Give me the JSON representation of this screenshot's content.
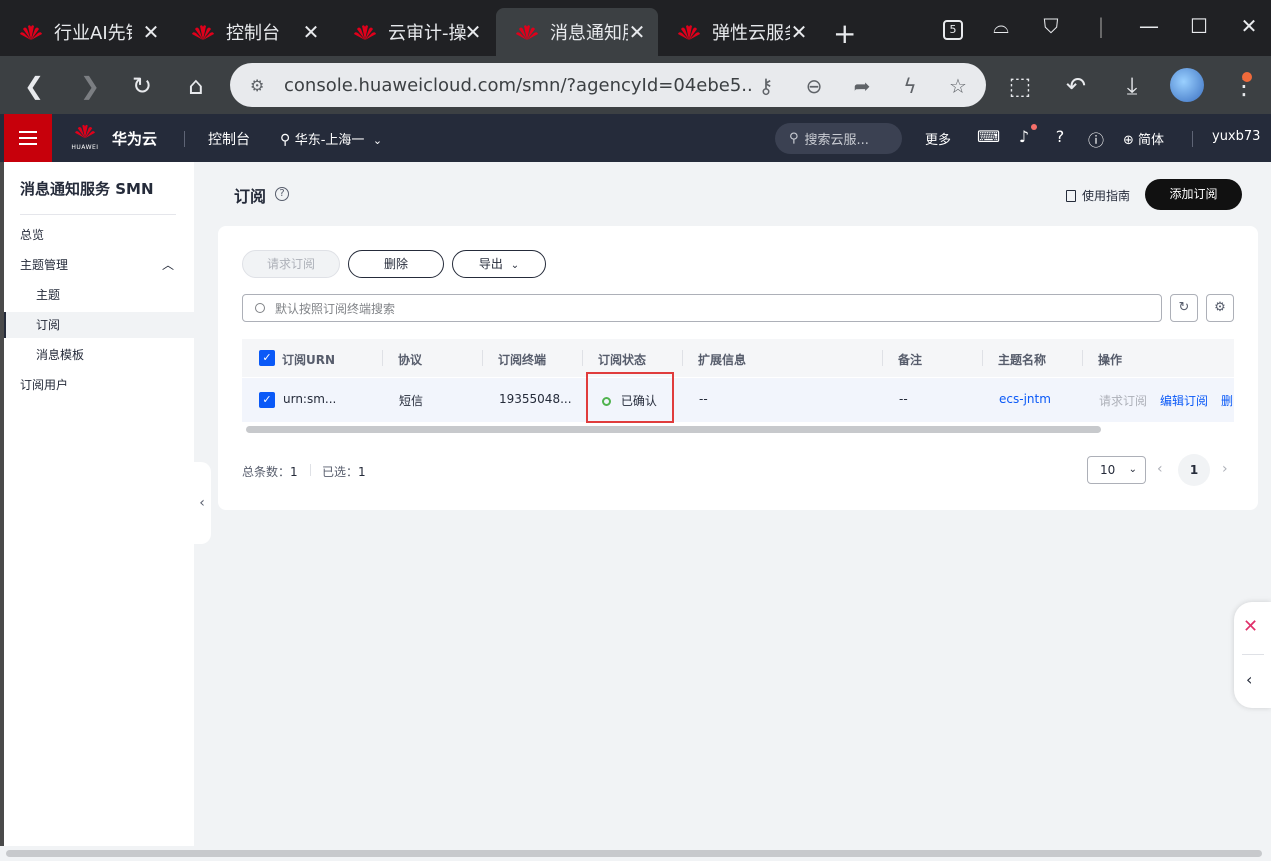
{
  "browser": {
    "tabs": [
      {
        "label": "行业AI先锋"
      },
      {
        "label": "控制台"
      },
      {
        "label": "云审计-操作"
      },
      {
        "label": "消息通知服务"
      },
      {
        "label": "弹性云服务器"
      }
    ],
    "url": "console.huaweicloud.com/smn/?agencyId=04ebe5...",
    "tab_count_badge": "5"
  },
  "header": {
    "brand": "华为云",
    "logo_text": "HUAWEI",
    "console": "控制台",
    "region": "华东-上海一",
    "search_placeholder": "搜索云服...",
    "more": "更多",
    "lang": "简体",
    "user": "yuxb73"
  },
  "sidebar": {
    "title": "消息通知服务 SMN",
    "items": [
      {
        "label": "总览"
      },
      {
        "label": "主题管理"
      },
      {
        "label": "主题"
      },
      {
        "label": "订阅"
      },
      {
        "label": "消息模板"
      },
      {
        "label": "订阅用户"
      }
    ]
  },
  "page": {
    "title": "订阅",
    "guide": "使用指南",
    "add_button": "添加订阅",
    "toolbar": {
      "request": "请求订阅",
      "delete": "删除",
      "export": "导出"
    },
    "search_placeholder": "默认按照订阅终端搜索",
    "table": {
      "columns": [
        "订阅URN",
        "协议",
        "订阅终端",
        "订阅状态",
        "扩展信息",
        "备注",
        "主题名称",
        "操作"
      ],
      "rows": [
        {
          "urn": "urn:sm...",
          "protocol": "短信",
          "endpoint": "19355048...",
          "status": "已确认",
          "ext": "--",
          "remark": "--",
          "topic": "ecs-jntm",
          "ops": [
            "请求订阅",
            "编辑订阅",
            "删"
          ]
        }
      ]
    },
    "footer": {
      "total_label": "总条数：",
      "total": "1",
      "selected_label": "已选：",
      "selected": "1",
      "page_size": "10",
      "page": "1"
    }
  },
  "colors": {
    "brand_red": "#c7000b",
    "link_blue": "#0a59f7",
    "status_green": "#50b34e",
    "highlight_red": "#e03c3c"
  }
}
